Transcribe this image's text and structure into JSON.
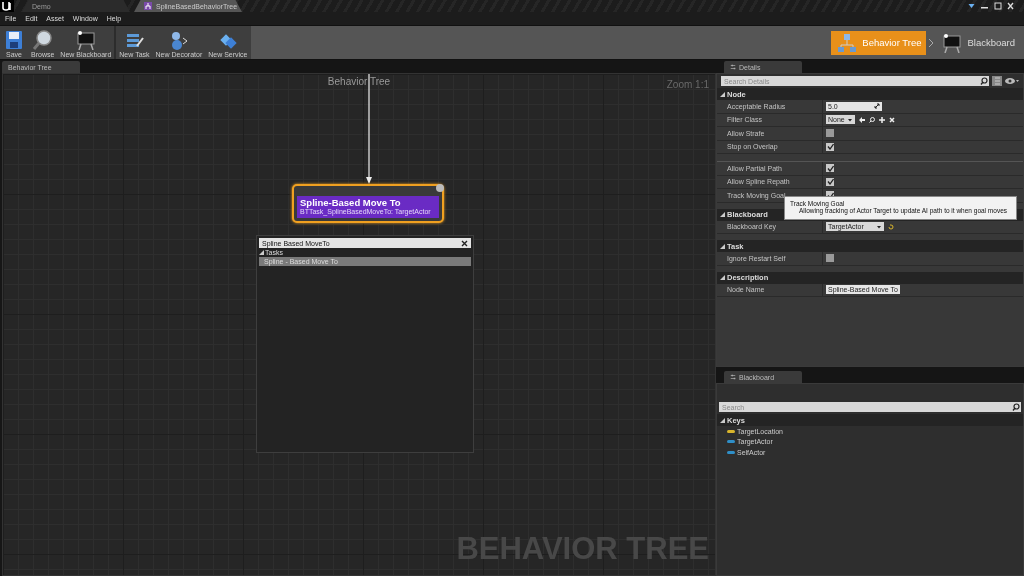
{
  "title_bar": {
    "tabs": [
      {
        "label": "Demo",
        "selected": false
      },
      {
        "label": "SplineBasedBehaviorTree",
        "selected": true
      }
    ]
  },
  "menu": [
    "File",
    "Edit",
    "Asset",
    "Window",
    "Help"
  ],
  "toolbar": {
    "buttons": [
      {
        "label": "Save",
        "kind": "save"
      },
      {
        "label": "Browse",
        "kind": "browse"
      },
      {
        "label": "New Blackboard",
        "kind": "blackboard"
      },
      {
        "label": "New Task",
        "kind": "task"
      },
      {
        "label": "New Decorator",
        "kind": "decorator"
      },
      {
        "label": "New Service",
        "kind": "service"
      }
    ],
    "modes": [
      {
        "label": "Behavior Tree",
        "kind": "tree",
        "selected": true
      },
      {
        "label": "Blackboard",
        "kind": "blackboard",
        "selected": false
      }
    ]
  },
  "graph": {
    "tab": "Behavior Tree",
    "title": "Behavior Tree",
    "zoom": "Zoom 1:1",
    "watermark": "BEHAVIOR TREE",
    "node": {
      "title": "Spline-Based Move To",
      "subtitle": "BTTask_SplineBasedMoveTo: TargetActor",
      "selected": true
    },
    "action_menu": {
      "query": "Spline Based MoveTo",
      "categories": [
        {
          "label": "Tasks",
          "expanded": true,
          "items": [
            {
              "label": "Spline - Based Move To",
              "selected": true
            }
          ]
        }
      ]
    }
  },
  "details": {
    "tab": "Details",
    "search": {
      "placeholder": "Search Details"
    },
    "sections": [
      {
        "label": "Node",
        "expanded": true,
        "groups": [
          [
            {
              "label": "Acceptable Radius",
              "kind": "number",
              "value": "5.0"
            },
            {
              "label": "Filter Class",
              "kind": "class",
              "value": "None"
            },
            {
              "label": "Allow Strafe",
              "kind": "checkbox",
              "checked": false
            },
            {
              "label": "Stop on Overlap",
              "kind": "checkbox",
              "checked": true
            }
          ],
          [
            {
              "label": "Allow Partial Path",
              "kind": "checkbox",
              "checked": true
            },
            {
              "label": "Allow Spline Repath",
              "kind": "checkbox",
              "checked": true
            },
            {
              "label": "Track Moving Goal",
              "kind": "checkbox",
              "checked": true
            }
          ]
        ]
      },
      {
        "label": "Blackboard",
        "expanded": true,
        "groups": [
          [
            {
              "label": "Blackboard Key",
              "kind": "combo",
              "value": "TargetActor"
            }
          ]
        ]
      },
      {
        "label": "Task",
        "expanded": true,
        "groups": [
          [
            {
              "label": "Ignore Restart Self",
              "kind": "checkbox",
              "checked": false
            }
          ]
        ]
      },
      {
        "label": "Description",
        "expanded": true,
        "groups": [
          [
            {
              "label": "Node Name",
              "kind": "text",
              "value": "Spline-Based Move To"
            }
          ]
        ]
      }
    ],
    "tooltip": {
      "title": "Track Moving Goal",
      "text": "Allowing tracking of Actor Target to update AI path to it when goal moves"
    }
  },
  "blackboard": {
    "tab": "Blackboard",
    "search": {
      "placeholder": "Search"
    },
    "category": {
      "label": "Keys",
      "expanded": true
    },
    "keys": [
      {
        "name": "TargetLocation",
        "color": "#d9b52c"
      },
      {
        "name": "TargetActor",
        "color": "#2f8fc8"
      },
      {
        "name": "SelfActor",
        "color": "#2f8fc8"
      }
    ]
  }
}
